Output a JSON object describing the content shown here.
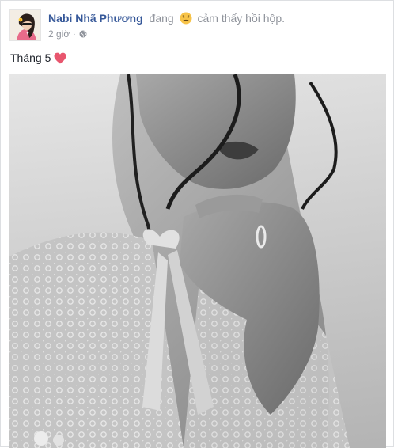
{
  "post": {
    "author_name": "Nabi Nhã Phương",
    "feeling_prefix": "đang",
    "feeling_text": "cảm thấy hồi hộp.",
    "time": "2 giờ",
    "audience_icon": "globe-icon",
    "message": "Tháng 5",
    "message_emoji": "heart-icon",
    "feeling_emoji": "nervous-face-icon",
    "colors": {
      "author": "#365899",
      "meta": "#90949c",
      "text": "#1d2129",
      "heart": "#e8566e",
      "emoji": "#f7c348"
    }
  }
}
